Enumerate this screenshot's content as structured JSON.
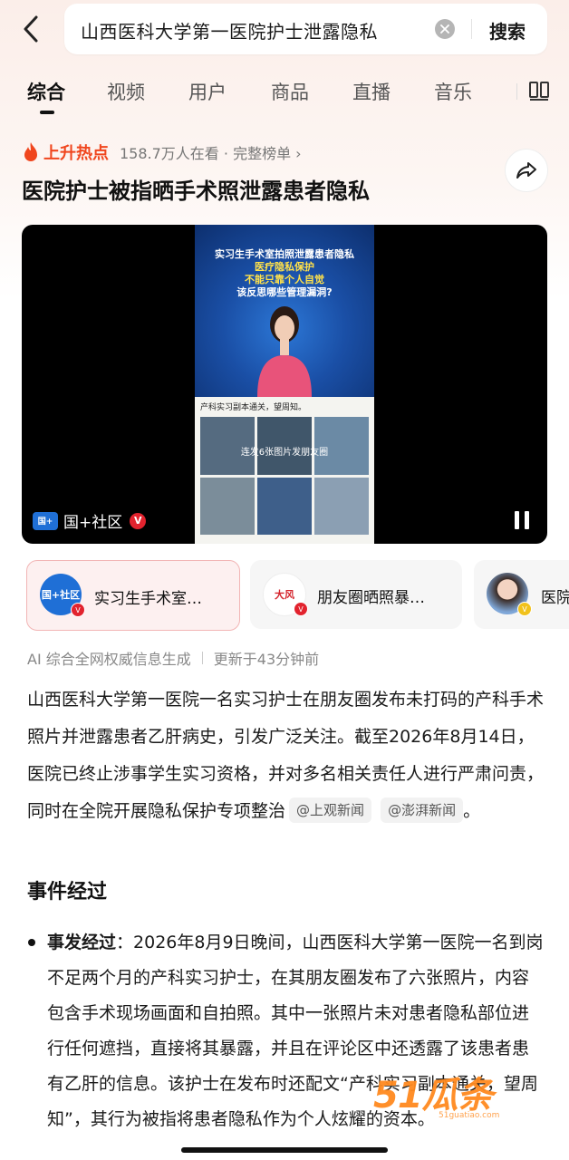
{
  "header": {
    "back_icon": "chevron-left-icon",
    "search_query": "山西医科大学第一医院护士泄露隐私",
    "search_button": "搜索"
  },
  "tabs": {
    "items": [
      "综合",
      "视频",
      "用户",
      "商品",
      "直播",
      "音乐"
    ],
    "active_index": 0,
    "more_icon": "book-icon"
  },
  "trend": {
    "label": "上升热点",
    "meta": "158.7万人在看 · 完整榜单 ›",
    "title": "医院护士被指晒手术照泄露患者隐私",
    "accent_color": "#f0461e"
  },
  "video": {
    "caption_line1": "实习生手术室拍照泄露患者隐私",
    "caption_line2": "医疗隐私保护",
    "caption_line3": "不能只靠个人自觉",
    "caption_line4": "该反思哪些管理漏洞?",
    "note": "产科实习副本通关，望周知。",
    "overlay_text": "连发6张图片发朋友圈",
    "source_logo": "国+",
    "source_name": "国+社区",
    "verified": "V"
  },
  "cards": [
    {
      "title": "实习生手术室…",
      "logo": "国+社区",
      "badge": "V"
    },
    {
      "title": "朋友圈晒照暴…",
      "logo": "大风",
      "badge": "V"
    },
    {
      "title": "医院",
      "logo": "",
      "badge": "V"
    }
  ],
  "ai_meta": {
    "label": "AI 综合全网权威信息生成",
    "updated": "更新于43分钟前"
  },
  "summary": {
    "text": "山西医科大学第一医院一名实习护士在朋友圈发布未打码的产科手术照片并泄露患者乙肝病史，引发广泛关注。截至2026年8月14日，医院已终止涉事学生实习资格，并对多名相关责任人进行严肃问责，同时在全院开展隐私保护专项整治",
    "source1": "@上观新闻",
    "source2": "@澎湃新闻",
    "end": "。"
  },
  "section": {
    "title": "事件经过",
    "bullet_label": "事发经过",
    "bullet_text": "：2026年8月9日晚间，山西医科大学第一医院一名到岗不足两个月的产科实习护士，在其朋友圈发布了六张照片，内容包含手术现场画面和自拍照。其中一张照片未对患者隐私部位进行任何遮挡，直接将其暴露，并且在评论区中还透露了该患者患有乙肝的信息。该护士在发布时还配文“产科实习副本通关，望周知”，其行为被指将患者隐私作为个人炫耀的资本。"
  },
  "watermark": {
    "text": "51瓜条",
    "sub": "51guatiao.com"
  }
}
